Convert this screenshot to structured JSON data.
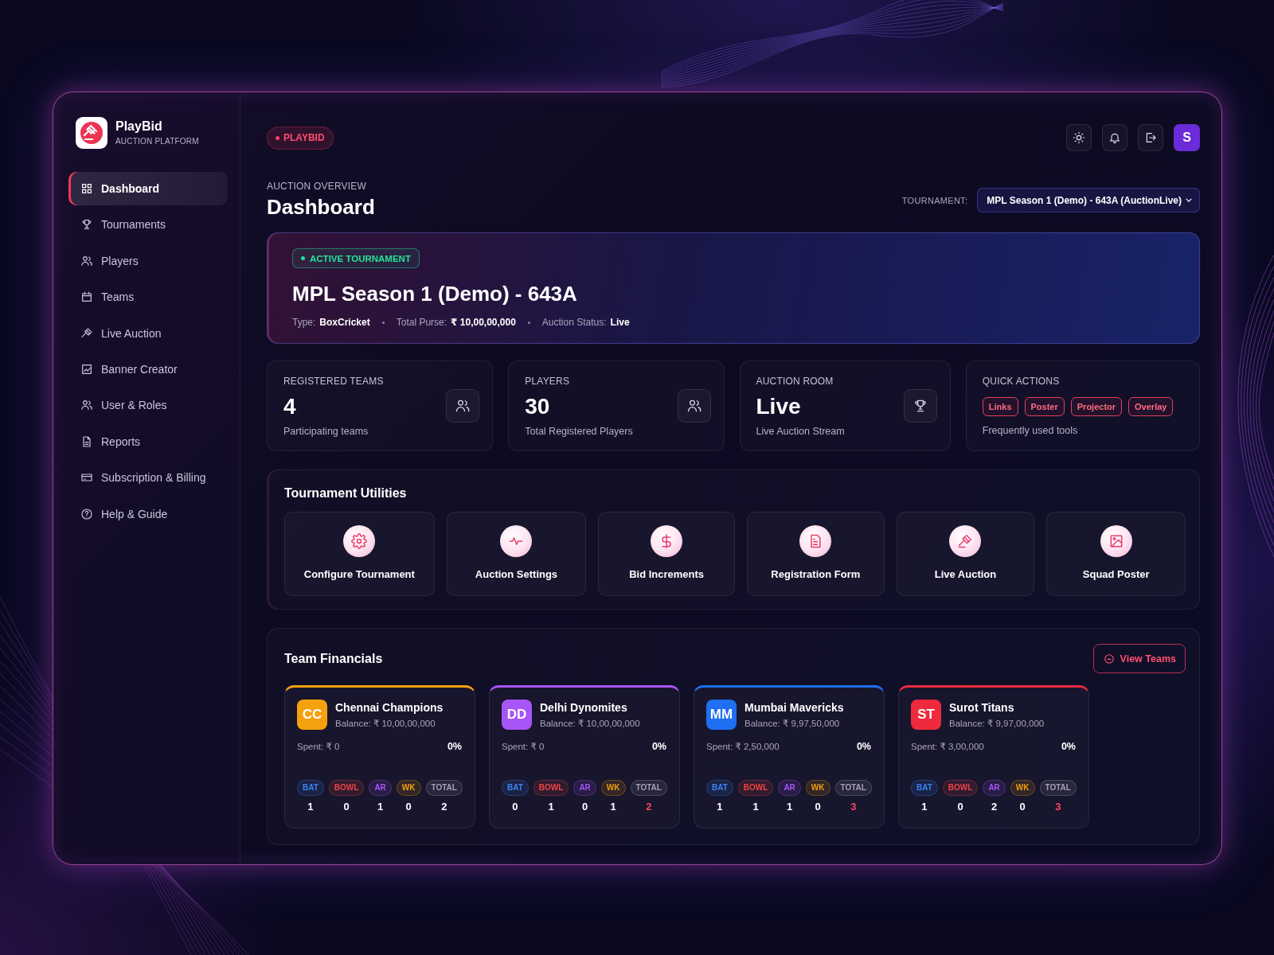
{
  "brand": {
    "name": "PlayBid",
    "tagline": "AUCTION PLATFORM"
  },
  "sidebar": {
    "items": [
      {
        "label": "Dashboard",
        "selected": true
      },
      {
        "label": "Tournaments",
        "selected": false
      },
      {
        "label": "Players",
        "selected": false
      },
      {
        "label": "Teams",
        "selected": false
      },
      {
        "label": "Live Auction",
        "selected": false
      },
      {
        "label": "Banner Creator",
        "selected": false
      },
      {
        "label": "User & Roles",
        "selected": false
      },
      {
        "label": "Reports",
        "selected": false
      },
      {
        "label": "Subscription & Billing",
        "selected": false
      },
      {
        "label": "Help & Guide",
        "selected": false
      }
    ]
  },
  "header": {
    "badge": "PLAYBID",
    "avatar": "S"
  },
  "page": {
    "eyebrow": "AUCTION OVERVIEW",
    "title": "Dashboard",
    "tournament_label": "TOURNAMENT:",
    "tournament_value": "MPL Season 1 (Demo) - 643A (AuctionLive)"
  },
  "active_tournament": {
    "badge": "ACTIVE TOURNAMENT",
    "title": "MPL Season 1 (Demo) - 643A",
    "meta": [
      {
        "label": "Type:",
        "value": "BoxCricket"
      },
      {
        "label": "Total Purse:",
        "value": "₹ 10,00,00,000"
      },
      {
        "label": "Auction Status:",
        "value": "Live"
      }
    ]
  },
  "stats": [
    {
      "kind": "metric",
      "label": "REGISTERED TEAMS",
      "value": "4",
      "caption": "Participating teams"
    },
    {
      "kind": "metric",
      "label": "PLAYERS",
      "value": "30",
      "caption": "Total Registered Players"
    },
    {
      "kind": "metric",
      "label": "AUCTION ROOM",
      "value": "Live",
      "caption": "Live Auction Stream"
    },
    {
      "kind": "actions",
      "label": "QUICK ACTIONS",
      "actions": [
        "Links",
        "Poster",
        "Projector",
        "Overlay"
      ],
      "caption": "Frequently used tools"
    }
  ],
  "utilities": {
    "title": "Tournament Utilities",
    "items": [
      "Configure Tournament",
      "Auction Settings",
      "Bid Increments",
      "Registration Form",
      "Live Auction",
      "Squad Poster"
    ]
  },
  "financials": {
    "title": "Team Financials",
    "view_button": "View Teams",
    "teams": [
      {
        "initials": "CC",
        "name": "Chennai Champions",
        "color": "#f5a00f",
        "balance": "Balance: ₹ 10,00,00,000",
        "spent": "Spent: ₹ 0",
        "percent": "0%",
        "roles": [
          {
            "label": "BAT",
            "color": "#3b82f6",
            "count": "1",
            "highlighted": false
          },
          {
            "label": "BOWL",
            "color": "#ef4444",
            "count": "0",
            "highlighted": false
          },
          {
            "label": "AR",
            "color": "#a855f7",
            "count": "1",
            "highlighted": false
          },
          {
            "label": "WK",
            "color": "#f59e0b",
            "count": "0",
            "highlighted": false
          },
          {
            "label": "TOTAL",
            "color": "#a3a0b5",
            "count": "2",
            "highlighted": false
          }
        ]
      },
      {
        "initials": "DD",
        "name": "Delhi Dynomites",
        "color": "#a855f7",
        "balance": "Balance: ₹ 10,00,00,000",
        "spent": "Spent: ₹ 0",
        "percent": "0%",
        "roles": [
          {
            "label": "BAT",
            "color": "#3b82f6",
            "count": "0",
            "highlighted": false
          },
          {
            "label": "BOWL",
            "color": "#ef4444",
            "count": "1",
            "highlighted": false
          },
          {
            "label": "AR",
            "color": "#a855f7",
            "count": "0",
            "highlighted": false
          },
          {
            "label": "WK",
            "color": "#f59e0b",
            "count": "1",
            "highlighted": false
          },
          {
            "label": "TOTAL",
            "color": "#a3a0b5",
            "count": "2",
            "highlighted": true
          }
        ]
      },
      {
        "initials": "MM",
        "name": "Mumbai Mavericks",
        "color": "#1f6ff2",
        "balance": "Balance: ₹ 9,97,50,000",
        "spent": "Spent: ₹ 2,50,000",
        "percent": "0%",
        "roles": [
          {
            "label": "BAT",
            "color": "#3b82f6",
            "count": "1",
            "highlighted": false
          },
          {
            "label": "BOWL",
            "color": "#ef4444",
            "count": "1",
            "highlighted": false
          },
          {
            "label": "AR",
            "color": "#a855f7",
            "count": "1",
            "highlighted": false
          },
          {
            "label": "WK",
            "color": "#f59e0b",
            "count": "0",
            "highlighted": false
          },
          {
            "label": "TOTAL",
            "color": "#a3a0b5",
            "count": "3",
            "highlighted": true
          }
        ]
      },
      {
        "initials": "ST",
        "name": "Surot Titans",
        "color": "#ee2a3c",
        "balance": "Balance: ₹ 9,97,00,000",
        "spent": "Spent: ₹ 3,00,000",
        "percent": "0%",
        "roles": [
          {
            "label": "BAT",
            "color": "#3b82f6",
            "count": "1",
            "highlighted": false
          },
          {
            "label": "BOWL",
            "color": "#ef4444",
            "count": "0",
            "highlighted": false
          },
          {
            "label": "AR",
            "color": "#a855f7",
            "count": "2",
            "highlighted": false
          },
          {
            "label": "WK",
            "color": "#f59e0b",
            "count": "0",
            "highlighted": false
          },
          {
            "label": "TOTAL",
            "color": "#a3a0b5",
            "count": "3",
            "highlighted": true
          }
        ]
      }
    ]
  }
}
